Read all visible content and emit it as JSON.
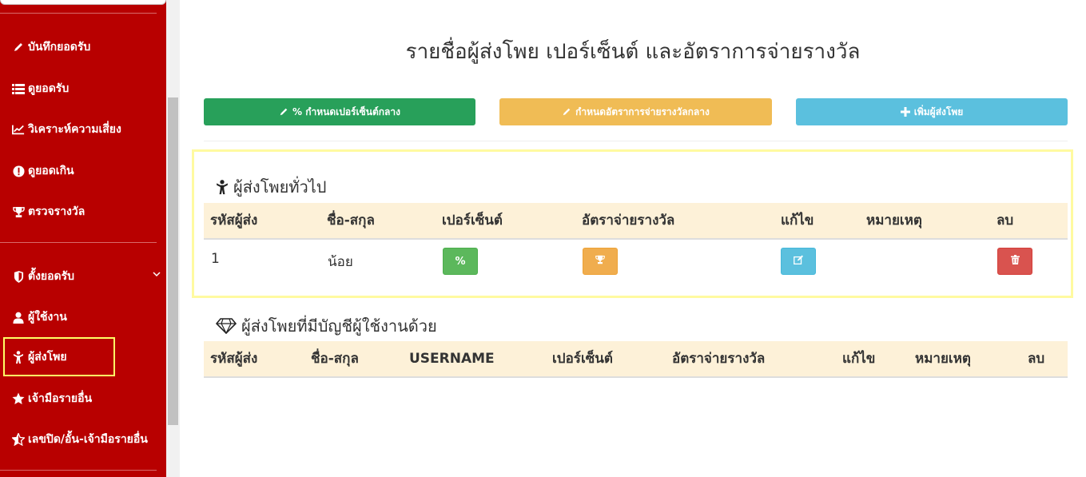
{
  "sidebar": {
    "items": [
      {
        "label": "บันทึกยอดรับ",
        "icon": "pencil-icon"
      },
      {
        "label": "ดูยอดรับ",
        "icon": "list-icon"
      },
      {
        "label": "วิเคราะห์ความเสี่ยง",
        "icon": "line-chart-icon"
      },
      {
        "label": "ดูยอดเกิน",
        "icon": "exclamation-circle-icon"
      },
      {
        "label": "ตรวจรางวัล",
        "icon": "trophy-icon"
      },
      {
        "label": "ตั้งยอดรับ",
        "icon": "shield-icon"
      },
      {
        "label": "ผู้ใช้งาน",
        "icon": "user-icon"
      },
      {
        "label": "ผู้ส่งโพย",
        "icon": "child-icon"
      },
      {
        "label": "เจ้ามือรายอื่น",
        "icon": "star-icon"
      },
      {
        "label": "เลขปิด/อั้น-เจ้ามือรายอื่น",
        "icon": "star-half-icon"
      }
    ]
  },
  "page": {
    "title": "รายชื่อผู้ส่งโพย เปอร์เซ็นต์ และอัตราการจ่ายรางวัล"
  },
  "toolbar": {
    "percent_label": "% กำหนดเปอร์เซ็นต์กลาง",
    "payout_label": "กำหนดอัตราการจ่ายรางวัลกลาง",
    "add_label": "เพิ่มผู้ส่งโพย"
  },
  "general": {
    "title": "ผู้ส่งโพยทั่วไป",
    "headers": [
      "รหัสผู้ส่ง",
      "ชื่อ-สกุล",
      "เปอร์เซ็นต์",
      "อัตราจ่ายรางวัล",
      "แก้ไข",
      "หมายเหตุ",
      "ลบ"
    ],
    "rows": [
      {
        "id": "1",
        "name": "น้อย",
        "percent_btn": "%",
        "note": ""
      }
    ]
  },
  "account": {
    "title": "ผู้ส่งโพยที่มีบัญชีผู้ใช้งานด้วย",
    "headers": [
      "รหัสผู้ส่ง",
      "ชื่อ-สกุล",
      "USERNAME",
      "เปอร์เซ็นต์",
      "อัตราจ่ายรางวัล",
      "แก้ไข",
      "หมายเหตุ",
      "ลบ"
    ]
  },
  "colors": {
    "sidebar": "#b80000",
    "green": "#28a05a",
    "orange": "#f0bc55",
    "blue": "#5bc0de",
    "red": "#d9534f",
    "table_header": "#fdf1d8",
    "highlight": "#ffff66"
  }
}
